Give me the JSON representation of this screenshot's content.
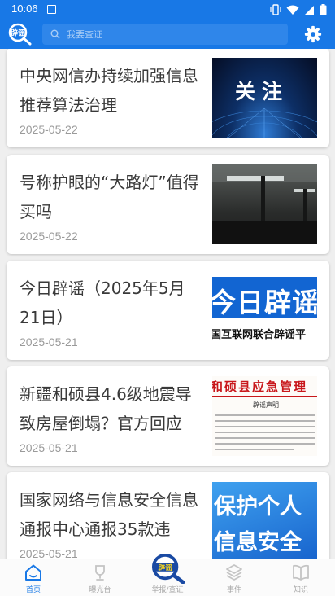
{
  "status_bar": {
    "time": "10:06"
  },
  "header": {
    "logo_text": "辟谣",
    "search_placeholder": "我要查证",
    "settings_icon": "gear-icon"
  },
  "colors": {
    "primary": "#1878e6",
    "title_text": "#3a3a3a",
    "date_text": "#9a9a9a",
    "inactive": "#a8a8a8"
  },
  "articles": [
    {
      "title": "中央网信办持续加强信息推荐算法治理",
      "date": "2025-05-22",
      "thumb_text": "关注"
    },
    {
      "title": "号称护眼的“大路灯”值得买吗",
      "date": "2025-05-22",
      "thumb_text": ""
    },
    {
      "title": "今日辟谣（2025年5月21日）",
      "date": "2025-05-21",
      "thumb_text": "今日辟谣",
      "thumb_subtext": "国互联网联合辟谣平"
    },
    {
      "title": "新疆和硕县4.6级地震导致房屋倒塌？官方回应",
      "date": "2025-05-21",
      "thumb_text": "和硕县应急管理",
      "thumb_subtext": "辟谣声明"
    },
    {
      "title": "国家网络与信息安全信息通报中心通报35款违",
      "date": "2025-05-21",
      "thumb_text": "保护个人",
      "thumb_subtext": "信息安全"
    }
  ],
  "bottom_nav": [
    {
      "label": "首页",
      "icon": "home-icon",
      "active": true
    },
    {
      "label": "曝光台",
      "icon": "trophy-icon",
      "active": false
    },
    {
      "label": "举报/查证",
      "icon": "report-logo-icon",
      "active": false
    },
    {
      "label": "事件",
      "icon": "layers-icon",
      "active": false
    },
    {
      "label": "知识",
      "icon": "book-icon",
      "active": false
    }
  ]
}
